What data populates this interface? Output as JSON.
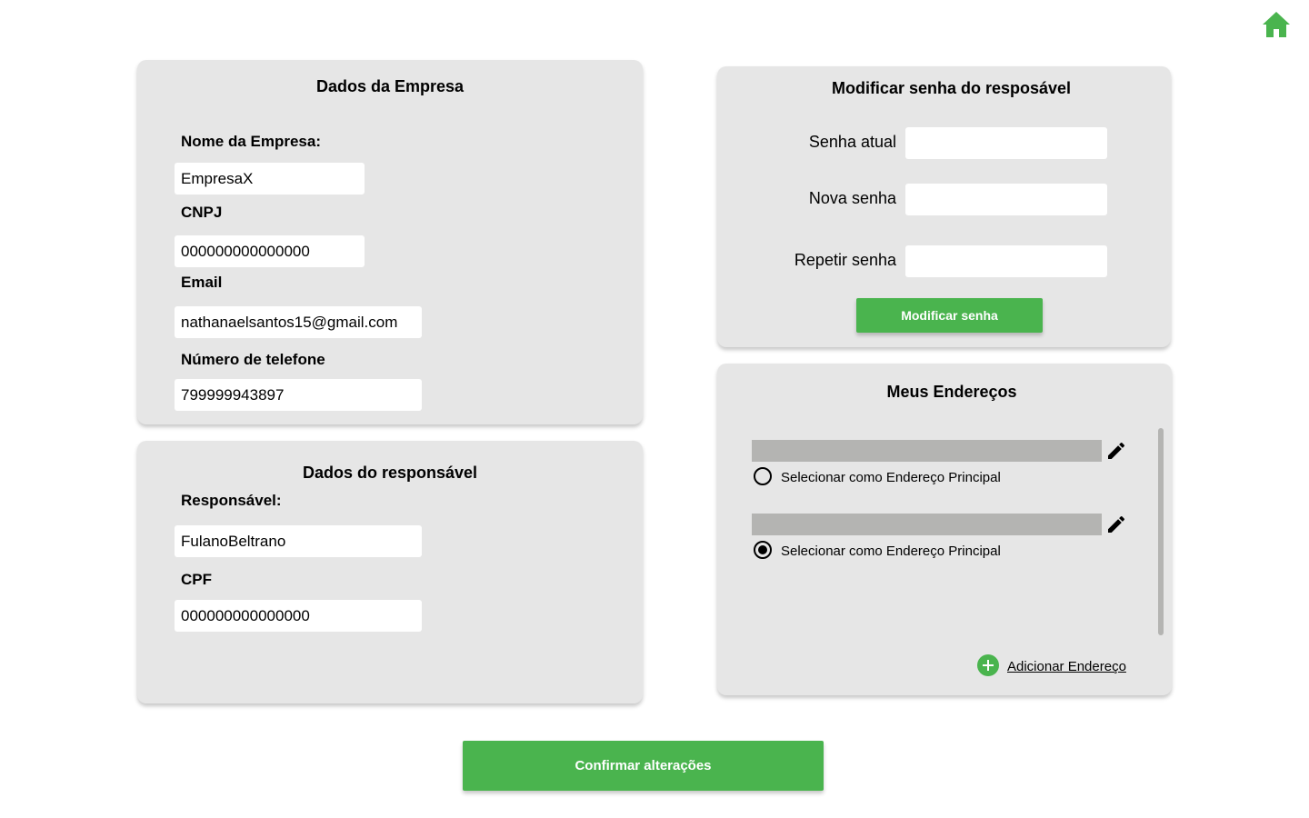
{
  "header": {
    "home_icon": "home-icon",
    "accent_color": "#4ab44e"
  },
  "company": {
    "title": "Dados da Empresa",
    "name_label": "Nome da Empresa:",
    "name_value": "EmpresaX",
    "cnpj_label": "CNPJ",
    "cnpj_value": "000000000000000",
    "email_label": "Email",
    "email_value": "nathanaelsantos15@gmail.com",
    "phone_label": "Número de telefone",
    "phone_value": "799999943897"
  },
  "responsible": {
    "title": "Dados do responsável",
    "name_label": "Responsável:",
    "name_value": "FulanoBeltrano",
    "cpf_label": "CPF",
    "cpf_value": "000000000000000"
  },
  "password": {
    "title": "Modificar  senha do resposável",
    "current_label": "Senha atual",
    "current_value": "",
    "new_label": "Nova senha",
    "new_value": "",
    "repeat_label": "Repetir senha",
    "repeat_value": "",
    "submit_label": "Modificar senha"
  },
  "addresses": {
    "title": "Meus Endereços",
    "items": [
      {
        "select_label": "Selecionar como Endereço Principal",
        "selected": false
      },
      {
        "select_label": "Selecionar como Endereço Principal",
        "selected": true
      }
    ],
    "add_label": "Adicionar Endereço"
  },
  "footer": {
    "confirm_label": "Confirmar alterações"
  }
}
